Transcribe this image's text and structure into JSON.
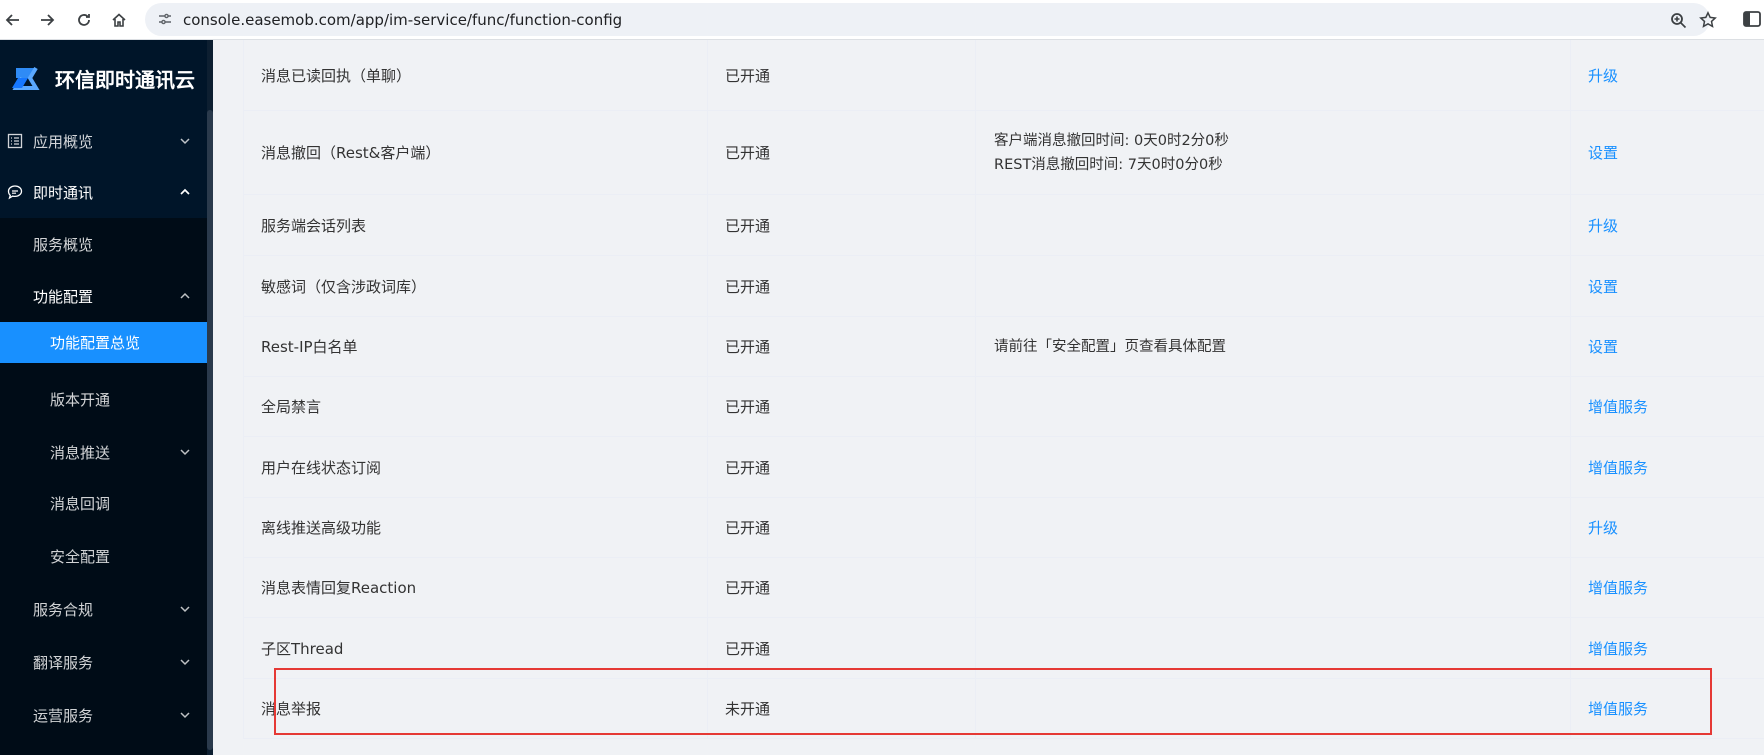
{
  "browser": {
    "url": "console.easemob.com/app/im-service/func/function-config"
  },
  "brand": {
    "name": "环信即时通讯云"
  },
  "sidebar": {
    "items": [
      {
        "label": "应用概览",
        "icon": "list-icon",
        "chevron": "down"
      },
      {
        "label": "即时通讯",
        "icon": "chat-icon",
        "chevron": "up"
      },
      {
        "label": "服务概览"
      },
      {
        "label": "功能配置",
        "chevron": "up"
      },
      {
        "label": "功能配置总览",
        "active": true
      },
      {
        "label": "版本开通"
      },
      {
        "label": "消息推送",
        "chevron": "down"
      },
      {
        "label": "消息回调"
      },
      {
        "label": "安全配置"
      },
      {
        "label": "服务合规",
        "chevron": "down"
      },
      {
        "label": "翻译服务",
        "chevron": "down"
      },
      {
        "label": "运营服务",
        "chevron": "down"
      }
    ]
  },
  "table": {
    "rows": [
      {
        "feature": "消息已读回执（单聊）",
        "status": "已开通",
        "details": [],
        "action": "升级"
      },
      {
        "feature": "消息撤回（Rest&客户端）",
        "status": "已开通",
        "details": [
          "客户端消息撤回时间: 0天0时2分0秒",
          "REST消息撤回时间: 7天0时0分0秒"
        ],
        "action": "设置"
      },
      {
        "feature": "服务端会话列表",
        "status": "已开通",
        "details": [],
        "action": "升级"
      },
      {
        "feature": "敏感词（仅含涉政词库）",
        "status": "已开通",
        "details": [],
        "action": "设置"
      },
      {
        "feature": "Rest-IP白名单",
        "status": "已开通",
        "details": [
          "请前往「安全配置」页查看具体配置"
        ],
        "action": "设置"
      },
      {
        "feature": "全局禁言",
        "status": "已开通",
        "details": [],
        "action": "增值服务"
      },
      {
        "feature": "用户在线状态订阅",
        "status": "已开通",
        "details": [],
        "action": "增值服务"
      },
      {
        "feature": "离线推送高级功能",
        "status": "已开通",
        "details": [],
        "action": "升级"
      },
      {
        "feature": "消息表情回复Reaction",
        "status": "已开通",
        "details": [],
        "action": "增值服务"
      },
      {
        "feature": "子区Thread",
        "status": "已开通",
        "details": [],
        "action": "增值服务"
      },
      {
        "feature": "消息举报",
        "status": "未开通",
        "details": [],
        "action": "增值服务"
      }
    ]
  },
  "colors": {
    "sidebar_bg": "#001529",
    "active": "#1890ff",
    "link": "#1890ff",
    "highlight": "#e53935"
  }
}
